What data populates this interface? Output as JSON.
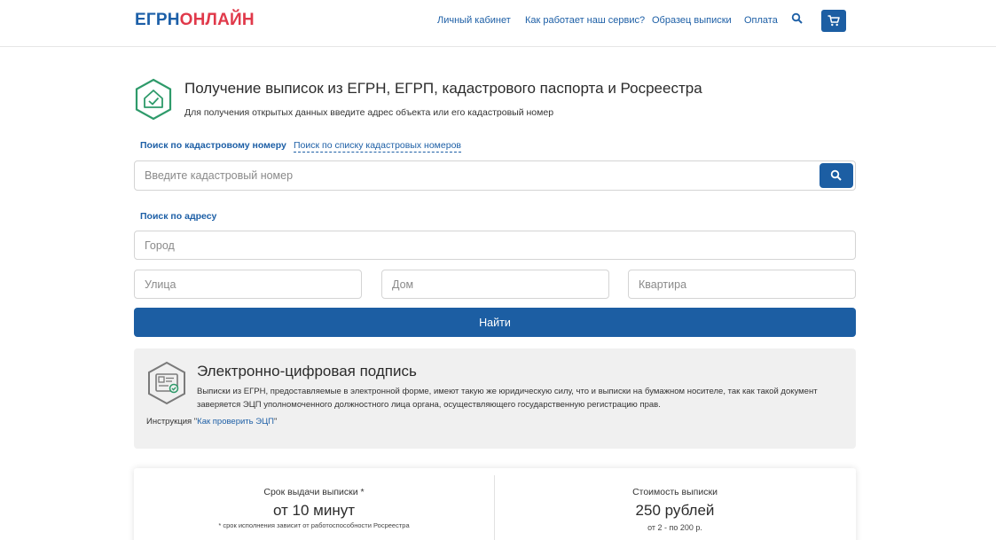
{
  "header": {
    "logo_part1": "ЕГРН",
    "logo_part2": "ОНЛАЙН",
    "nav": [
      "Личный кабинет",
      "Как работает наш сервис?",
      "Образец выписки",
      "Оплата"
    ],
    "search_icon": "search-icon",
    "cart_icon": "cart-icon"
  },
  "main": {
    "title": "Получение выписок из ЕГРН, ЕГРП, кадастрового паспорта и Росреестра",
    "subtitle": "Для получения открытых данных введите адрес объекта или его кадастровый номер",
    "tab_active": "Поиск по кадастровому номеру",
    "tab_link": "Поиск по списку кадастровых номеров",
    "cadastral_placeholder": "Введите кадастровый номер",
    "address_label": "Поиск по адресу",
    "city_placeholder": "Город",
    "street_placeholder": "Улица",
    "house_placeholder": "Дом",
    "apartment_placeholder": "Квартира",
    "find_button": "Найти"
  },
  "signature": {
    "title": "Электронно-цифровая подпись",
    "text": "Выписки из ЕГРН, предоставляемые в электронной форме, имеют такую же юридическую силу, что и выписки на бумажном носителе, так как такой документ заверяется ЭЦП уполномоченного должностного лица органа, осуществляющего государственную регистрацию прав.",
    "instruction_prefix": "Инструкция \"",
    "instruction_link": "Как проверить ЭЦП",
    "instruction_suffix": "\""
  },
  "info": {
    "term_label": "Срок выдачи выписки *",
    "term_value": "от 10 минут",
    "term_note": "* срок исполнения зависит от работоспособности Росреестра",
    "price_label": "Стоимость выписки",
    "price_value": "250 рублей",
    "price_note": "от 2 - по 200 р."
  },
  "colors": {
    "brand_blue": "#1c5ea3",
    "brand_red": "#e0394a",
    "icon_green": "#2e9a6a"
  }
}
